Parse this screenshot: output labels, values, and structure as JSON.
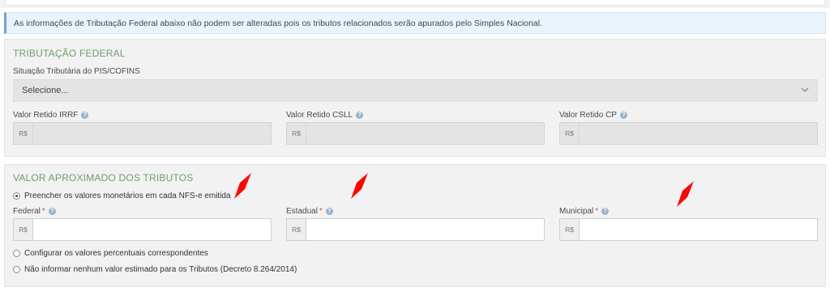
{
  "alert": {
    "text": "As informações de Tributação Federal abaixo não podem ser alteradas pois os tributos relacionados serão apurados pelo Simples Nacional."
  },
  "tributacao": {
    "title": "TRIBUTAÇÃO FEDERAL",
    "pis_label": "Situação Tributária do PIS/COFINS",
    "pis_value": "Selecione...",
    "irrf_label": "Valor Retido IRRF",
    "csll_label": "Valor Retido CSLL",
    "cp_label": "Valor Retido CP",
    "currency": "R$"
  },
  "valor": {
    "title": "VALOR APROXIMADO DOS TRIBUTOS",
    "option_monetario": "Preencher os valores monetários em cada NFS-e emitida",
    "federal_label": "Federal",
    "estadual_label": "Estadual",
    "municipal_label": "Municipal",
    "required_mark": "*",
    "currency": "R$",
    "option_percentual": "Configurar os valores percentuais correspondentes",
    "option_nenhum": "Não informar nenhum valor estimado para os Tributos (Decreto 8.264/2014)",
    "selected_option": "option_monetario"
  },
  "colors": {
    "section_title": "#6d9e6a",
    "annotation_arrow": "#ff0000",
    "required": "#d9534f"
  },
  "icons": {
    "help": "question-circle-icon",
    "dropdown": "chevron-down-icon"
  }
}
